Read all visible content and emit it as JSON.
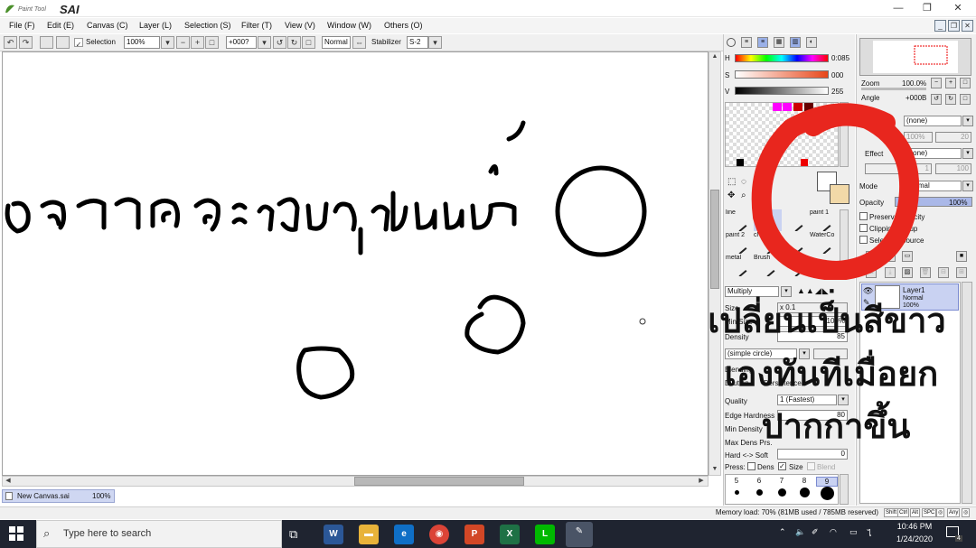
{
  "window": {
    "app_name": "SAI",
    "logo_small_text": "Paint Tool",
    "min_icon": "—",
    "restore_icon": "❐",
    "close_icon": "✕"
  },
  "menu": {
    "items": [
      "File (F)",
      "Edit (E)",
      "Canvas (C)",
      "Layer (L)",
      "Selection (S)",
      "Filter (T)",
      "View (V)",
      "Window (W)",
      "Others (O)"
    ]
  },
  "toolbar": {
    "selection_label": "Selection",
    "selection_checked": true,
    "zoom_value": "100%",
    "angle_value": "+000?",
    "blend_mode": "Normal",
    "stabilizer_label": "Stabilizer",
    "stabilizer_value": "S-2"
  },
  "color_panel": {
    "h_label": "H",
    "h_value": "0:085",
    "s_label": "S",
    "s_value": "000",
    "v_label": "V",
    "v_value": "255",
    "tools": [
      "line",
      "P",
      "",
      "paint 1",
      "paint 2",
      "cl",
      "",
      "WaterCo",
      "metal",
      "Brush",
      "",
      ""
    ],
    "blend_mode": "Multiply",
    "size_label": "Size",
    "size_mult": "x 0.1",
    "min_size_label": "Min Size",
    "min_size_value": "100%",
    "density_label": "Density",
    "density_value": "85",
    "shape_value": "(simple circle)",
    "blending_label": "Blending",
    "dilution_label": "Dilution",
    "persistence_label": "Persistence",
    "quality_label": "Quality",
    "quality_value": "1 (Fastest)",
    "edge_label": "Edge Hardness",
    "edge_value": "80",
    "min_dens_label": "Min Density",
    "max_prs_label": "Max Dens Prs.",
    "hard_soft_label": "Hard <-> Soft",
    "hard_soft_value": "0",
    "press_label": "Press:",
    "press_dens": "Dens",
    "press_size": "Size",
    "press_blend": "Blend",
    "press_dens_checked": false,
    "press_size_checked": true,
    "press_blend_checked": false,
    "size_presets": [
      "5",
      "6",
      "7",
      "8",
      "9"
    ],
    "size_presets_row2": [
      "",
      "",
      "",
      "",
      ""
    ]
  },
  "nav_panel": {
    "zoom_label": "Zoom",
    "zoom_value": "100.0%",
    "angle_label": "Angle",
    "angle_value": "+000B",
    "texture_value": "(none)",
    "texture_scale": "100%",
    "texture_strength": "20",
    "effect_label": "Effect",
    "effect_value": "(none)",
    "effect_width": "1",
    "effect_strength": "100",
    "mode_label": "Mode",
    "mode_value": "Normal",
    "opacity_label": "Opacity",
    "opacity_value": "100%",
    "opacity_fill": 1.0,
    "preserve_opacity": "Preserve Opacity",
    "clipping_group": "Clipping Group",
    "selection_source": "Selection Source",
    "layer_name": "Layer1",
    "layer_mode": "Normal",
    "layer_opacity": "100%"
  },
  "document": {
    "tab_name": "New Canvas.sai",
    "tab_zoom": "100%"
  },
  "status": {
    "memory_load": "Memory load: 70% (81MB used / 785MB reserved)",
    "keys": [
      "Shift",
      "Ctrl",
      "Alt",
      "SPC",
      "◎",
      "Any",
      "◎"
    ]
  },
  "taskbar": {
    "search_placeholder": "Type here to search",
    "time": "10:46 PM",
    "date": "1/24/2020",
    "notification_count": "4"
  },
  "overlay": {
    "line1": "เปลี่ยนเป็นสีขาว",
    "line2": "เองทันทีเมื่อยก",
    "line3": "ปากกาขึ้น"
  }
}
